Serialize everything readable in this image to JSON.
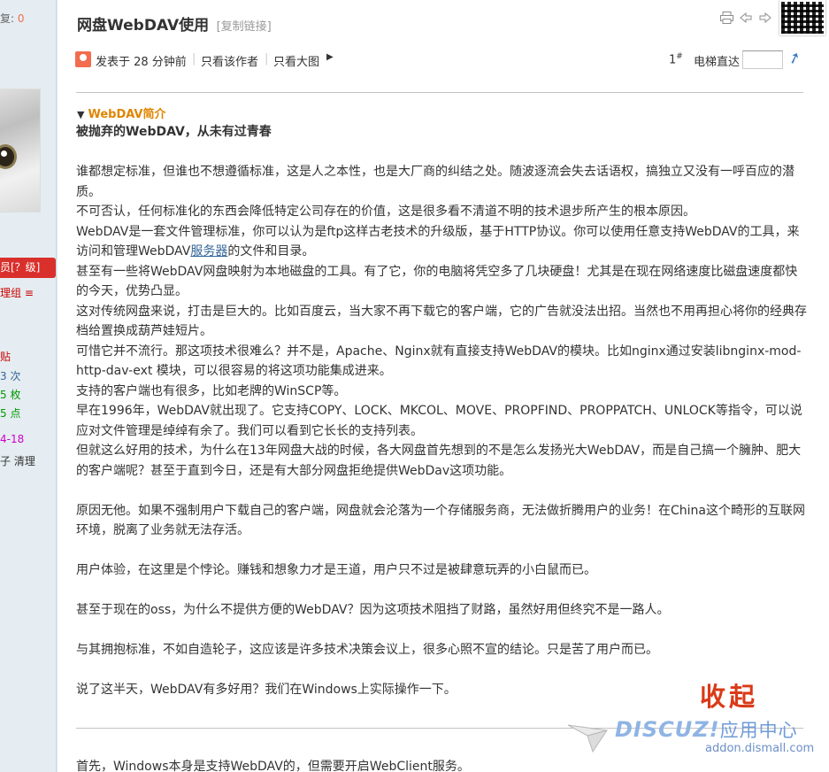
{
  "sidebar": {
    "reply_label": "复: ",
    "reply_count": "0",
    "group_badge": "员[？级]",
    "group_link": "理组 ≡",
    "stat1": "贴",
    "stat2": "3 次",
    "stat3": "5 枚",
    "stat4": "5 点",
    "stat5": "4-18",
    "stat6": "子 清理"
  },
  "post": {
    "title": "网盘WebDAV使用",
    "copy_link": "[复制链接]",
    "posted_time": "发表于 28 分钟前",
    "only_author": "只看该作者",
    "view_big_image": "只看大图",
    "floor_number": "1",
    "floor_suffix": "#",
    "floor_jump_label": "电梯直达",
    "intro_heading": "WebDAV简介",
    "subtitle": "被抛弃的WebDAV，从未有过青春",
    "p1": "谁都想定标准，但谁也不想遵循标准，这是人之本性，也是大厂商的纠结之处。随波逐流会失去话语权，搞独立又没有一呼百应的潜质。",
    "p2": "不可否认，任何标准化的东西会降低特定公司存在的价值，这是很多看不清道不明的技术退步所产生的根本原因。",
    "p3a": "WebDAV是一套文件管理标准，你可以认为是ftp这样古老技术的升级版，基于HTTP协议。你可以使用任意支持WebDAV的工具，来访问和管理WebDAV",
    "p3_link": "服务器",
    "p3b": "的文件和目录。",
    "p4": "甚至有一些将WebDAV网盘映射为本地磁盘的工具。有了它，你的电脑将凭空多了几块硬盘！尤其是在现在网络速度比磁盘速度都快的今天，优势凸显。",
    "p5": "这对传统网盘来说，打击是巨大的。比如百度云，当大家不再下载它的客户端，它的广告就没法出招。当然也不用再担心将你的经典存档给置换成葫芦娃短片。",
    "p6": "可惜它并不流行。那这项技术很难么？并不是，Apache、Nginx就有直接支持WebDAV的模块。比如nginx通过安装libnginx-mod-http-dav-ext 模块，可以很容易的将这项功能集成进来。",
    "p7": "支持的客户端也有很多，比如老牌的WinSCP等。",
    "p8": "早在1996年，WebDAV就出现了。它支持COPY、LOCK、MKCOL、MOVE、PROPFIND、PROPPATCH、UNLOCK等指令，可以说应对文件管理是绰绰有余了。我们可以看到它长长的支持列表。",
    "p9": "但就这么好用的技术，为什么在13年网盘大战的时候，各大网盘首先想到的不是怎么发扬光大WebDAV，而是自己搞一个臃肿、肥大的客户端呢？甚至于直到今日，还是有大部分网盘拒绝提供WebDav这项功能。",
    "p10": "原因无他。如果不强制用户下载自己的客户端，网盘就会沦落为一个存储服务商，无法做折腾用户的业务！在China这个畸形的互联网环境，脱离了业务就无法存活。",
    "p11": "用户体验，在这里是个悖论。赚钱和想象力才是王道，用户只不过是被肆意玩弄的小白鼠而已。",
    "p12": "甚至于现在的oss，为什么不提供方便的WebDAV？因为这项技术阻挡了财路，虽然好用但终究不是一路人。",
    "p13": "与其拥抱标准，不如自造轮子，这应该是许多技术决策会议上，很多心照不宣的结论。只是苦了用户而已。",
    "p14": "说了这半天，WebDAV有多好用？我们在Windows上实际操作一下。",
    "p15": "首先，Windows本身是支持WebDAV的，但需要开启WebClient服务。",
    "collapse": "收起"
  },
  "watermark": {
    "brand": "DISCUZ!",
    "brand_cn": "应用中心",
    "domain": "addon.dismall.com"
  },
  "icons": {
    "print": "print-icon",
    "prev": "prev-thread-icon",
    "next": "next-thread-icon",
    "go": "go-arrow-icon"
  },
  "colors": {
    "accent_orange": "#e08500",
    "badge_red": "#d9302c",
    "link_blue": "#336699",
    "collapse_red": "#d93a17"
  }
}
